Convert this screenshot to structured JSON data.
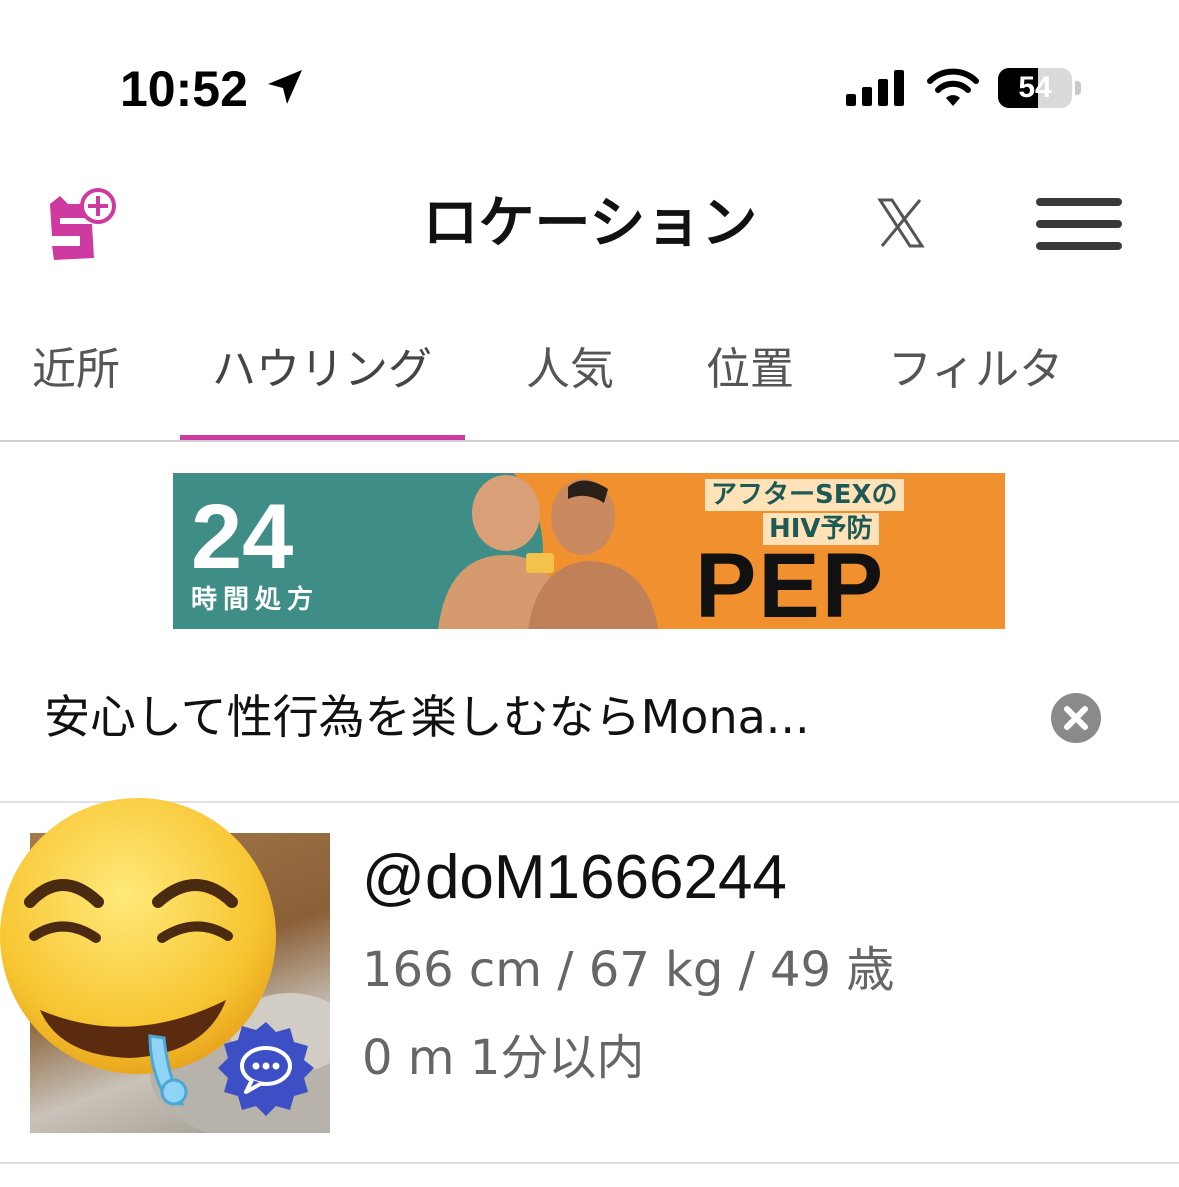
{
  "status_bar": {
    "time": "10:52",
    "battery_level": 54,
    "battery_text": "54",
    "icons": [
      "location-arrow-icon",
      "cellular-signal-icon",
      "wifi-icon",
      "battery-icon"
    ]
  },
  "header": {
    "title": "ロケーション",
    "logo_icon": "app-logo-icon",
    "x_icon": "x-icon",
    "menu_icon": "menu-icon"
  },
  "tabs": {
    "items": [
      {
        "label": "近所"
      },
      {
        "label": "ハウリング"
      },
      {
        "label": "人気"
      },
      {
        "label": "位置"
      },
      {
        "label": "フィルタ"
      }
    ],
    "active_index": 1
  },
  "ad": {
    "banner": {
      "number": "24",
      "subtitle": "時間処方",
      "headline1": "アフターSEXの",
      "headline2": "HIV予防",
      "brand": "PEP"
    },
    "caption": "安心して性行為を楽しむならMona...",
    "close_icon": "close-circle-icon"
  },
  "user": {
    "handle": "@doM1666244",
    "stats": "166 cm / 67 kg / 49 歳",
    "meta": "0 m  1分以内",
    "emoji_icon": "drooling-emoji-icon",
    "badge_icon": "chat-bubble-icon"
  },
  "colors": {
    "accent": "#cf3aa0",
    "banner_orange": "#f0902e",
    "banner_teal": "#3e8d86",
    "badge_blue": "#3d4fc4"
  }
}
